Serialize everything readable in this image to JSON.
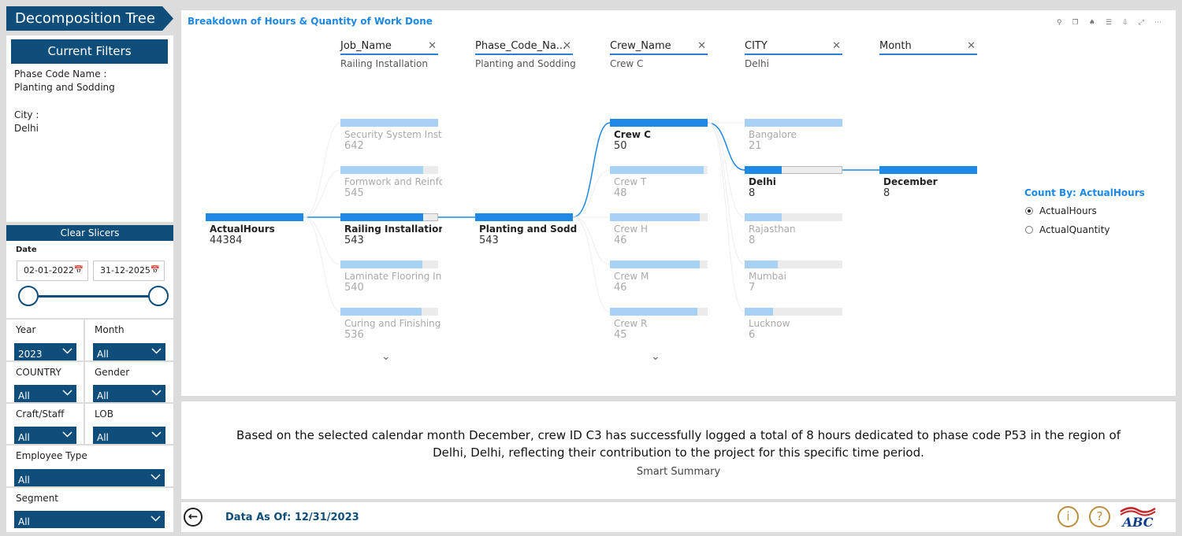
{
  "app": {
    "title": "Decomposition Tree"
  },
  "filters": {
    "header": "Current Filters",
    "phase_label": "Phase Code Name :",
    "phase_value": "Planting and Sodding",
    "city_label": "City :",
    "city_value": "Delhi"
  },
  "slicers": {
    "clear_label": "Clear Slicers",
    "date_label": "Date",
    "date_start": "02-01-2022",
    "date_end": "31-12-2025",
    "year": {
      "label": "Year",
      "value": "2023"
    },
    "month": {
      "label": "Month",
      "value": "All"
    },
    "country": {
      "label": "COUNTRY",
      "value": "All"
    },
    "gender": {
      "label": "Gender",
      "value": "All"
    },
    "craft": {
      "label": "Craft/Staff",
      "value": "All"
    },
    "lob": {
      "label": "LOB",
      "value": "All"
    },
    "employee_type": {
      "label": "Employee Type",
      "value": "All"
    },
    "segment": {
      "label": "Segment",
      "value": "All"
    }
  },
  "visual": {
    "title": "Breakdown of Hours & Quantity of Work Done",
    "levels": [
      {
        "header": "Job_Name",
        "selected": "Railing Installation"
      },
      {
        "header": "Phase_Code_Na...",
        "selected": "Planting and Sodding"
      },
      {
        "header": "Crew_Name",
        "selected": "Crew C"
      },
      {
        "header": "CITY",
        "selected": "Delhi"
      },
      {
        "header": "Month",
        "selected": ""
      }
    ],
    "root": {
      "label": "ActualHours",
      "value": "44384"
    },
    "job_nodes": [
      {
        "label": "Security System Install...",
        "value": "642"
      },
      {
        "label": "Formwork and Reinfor...",
        "value": "545"
      },
      {
        "label": "Railing Installation",
        "value": "543"
      },
      {
        "label": "Laminate Flooring Inst...",
        "value": "540"
      },
      {
        "label": "Curing and Finishing",
        "value": "536"
      }
    ],
    "phase_nodes": [
      {
        "label": "Planting and Sodding",
        "value": "543"
      }
    ],
    "crew_nodes": [
      {
        "label": "Crew C",
        "value": "50"
      },
      {
        "label": "Crew T",
        "value": "48"
      },
      {
        "label": "Crew H",
        "value": "46"
      },
      {
        "label": "Crew M",
        "value": "46"
      },
      {
        "label": "Crew R",
        "value": "45"
      }
    ],
    "city_nodes": [
      {
        "label": "Bangalore",
        "value": "21"
      },
      {
        "label": "Delhi",
        "value": "8"
      },
      {
        "label": "Rajasthan",
        "value": "8"
      },
      {
        "label": "Mumbai",
        "value": "7"
      },
      {
        "label": "Lucknow",
        "value": "6"
      }
    ],
    "month_nodes": [
      {
        "label": "December",
        "value": "8"
      }
    ],
    "count_by": {
      "title": "Count By: ActualHours",
      "options": [
        "ActualHours",
        "ActualQuantity"
      ],
      "selected": "ActualHours"
    },
    "colors": {
      "selected_bar": "#1e88e5",
      "dim_bar": "#a9d0f5",
      "accent": "#0f4d7a"
    }
  },
  "summary": {
    "text": "Based on the selected calendar month December, crew ID C3 has successfully logged a total of 8 hours dedicated to phase code P53 in the region of Delhi, Delhi, reflecting their contribution to the project for this specific time period.",
    "caption": "Smart Summary"
  },
  "footer": {
    "data_as_of": "Data As Of: 12/31/2023",
    "info_symbol": "i",
    "help_symbol": "?",
    "logo_text": "ABC"
  }
}
